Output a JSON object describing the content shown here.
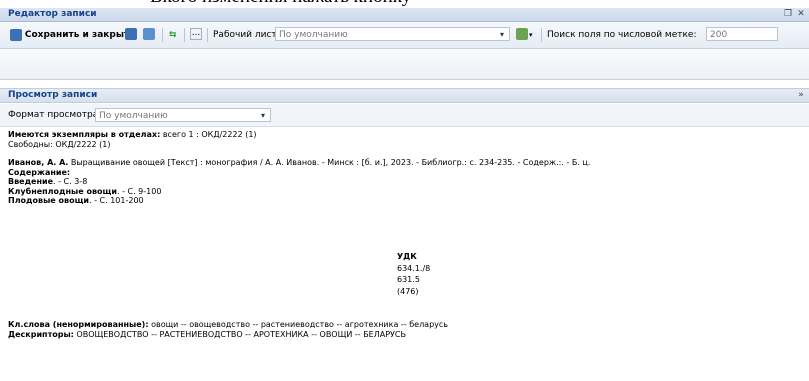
{
  "top_crop_text": "Вкого изменения нажать кнопку",
  "window": {
    "title": "Редактор записи"
  },
  "toolbar": {
    "save_close_label": "Сохранить и закрыть",
    "worksheet_label": "Рабочий лист:",
    "worksheet_value": "По умолчанию",
    "numeric_search_label": "Поиск поля по числовой метке:",
    "numeric_search_value": "200",
    "more_label": "..."
  },
  "view_section": {
    "title": "Просмотр записи",
    "format_label": "Формат просмотра",
    "format_value": "По умолчанию"
  },
  "record": {
    "copies_label": "Имеются экземпляры в отделах:",
    "copies_value": " всего 1 : ОКД/2222 (1)",
    "free_line": "Свободны: ОКД/2222 (1)",
    "author": "Иванов, А. А.",
    "description": " Выращивание овощей [Текст] : монография / А. А. Иванов. - Минск : [б. и.], 2023. - Библиогр.: с. 234-235. - Содерж.:. - Б. ц.",
    "contents_label": "Содержание:",
    "contents": [
      {
        "title": "Введение",
        "pages": ". - С. 3-8"
      },
      {
        "title": "Клубнеплодные овощи",
        "pages": ". - С. 9-100"
      },
      {
        "title": "Плодовые овощи",
        "pages": ". - С. 101-200"
      }
    ],
    "udk_label": "УДК",
    "udk_values": [
      "634.1./8",
      "631.5",
      "(476)"
    ],
    "keywords_label": "Кл.слова (ненормированные):",
    "keywords_value": " овощи -- овощеводство -- растениеводство -- агротехника -- беларусь",
    "descriptors_label": "Дескрипторы:",
    "descriptors_value": " ОВОЩЕВОДСТВО -- РАСТЕНИЕВОДСТВО -- АРОТЕХНИКА -- ОВОЩИ -- БЕЛАРУСЬ"
  }
}
